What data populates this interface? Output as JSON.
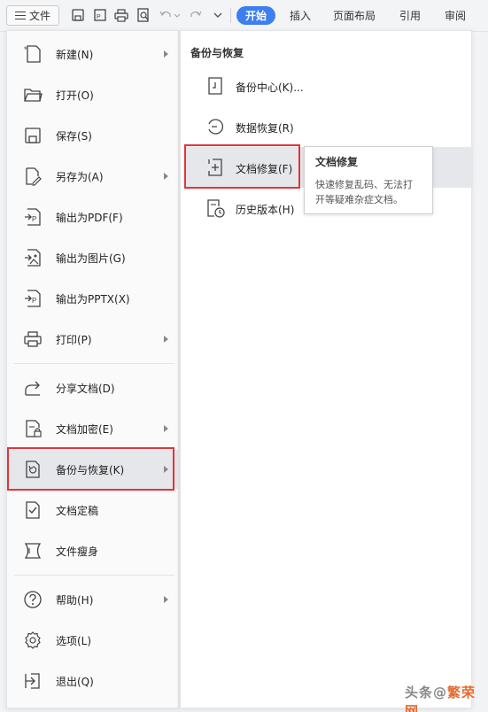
{
  "toolbar": {
    "file_label": "文件",
    "tabs": [
      {
        "label": "开始",
        "active": true
      },
      {
        "label": "插入"
      },
      {
        "label": "页面布局"
      },
      {
        "label": "引用"
      },
      {
        "label": "审阅"
      }
    ]
  },
  "menu": {
    "items": [
      {
        "label": "新建(N)",
        "icon": "new-doc-icon",
        "submenu": true
      },
      {
        "label": "打开(O)",
        "icon": "folder-open-icon",
        "submenu": false
      },
      {
        "label": "保存(S)",
        "icon": "save-icon",
        "submenu": false
      },
      {
        "label": "另存为(A)",
        "icon": "save-as-icon",
        "submenu": true
      },
      {
        "label": "输出为PDF(F)",
        "icon": "export-pdf-icon",
        "submenu": false
      },
      {
        "label": "输出为图片(G)",
        "icon": "export-image-icon",
        "submenu": false
      },
      {
        "label": "输出为PPTX(X)",
        "icon": "export-pptx-icon",
        "submenu": false
      },
      {
        "label": "打印(P)",
        "icon": "print-icon",
        "submenu": true
      },
      {
        "label": "分享文档(D)",
        "icon": "share-icon",
        "submenu": false
      },
      {
        "label": "文档加密(E)",
        "icon": "encrypt-doc-icon",
        "submenu": true
      },
      {
        "label": "备份与恢复(K)",
        "icon": "backup-restore-icon",
        "submenu": true,
        "highlighted": true
      },
      {
        "label": "文档定稿",
        "icon": "finalize-doc-icon",
        "submenu": false
      },
      {
        "label": "文件瘦身",
        "icon": "slim-file-icon",
        "submenu": false
      },
      {
        "label": "帮助(H)",
        "icon": "help-icon",
        "submenu": true
      },
      {
        "label": "选项(L)",
        "icon": "gear-icon",
        "submenu": false
      },
      {
        "label": "退出(Q)",
        "icon": "exit-icon",
        "submenu": false
      }
    ]
  },
  "submenu": {
    "title": "备份与恢复",
    "items": [
      {
        "label": "备份中心(K)...",
        "icon": "backup-center-icon"
      },
      {
        "label": "数据恢复(R)",
        "icon": "data-recovery-icon"
      },
      {
        "label": "文档修复(F)",
        "icon": "doc-repair-icon",
        "highlighted": true
      },
      {
        "label": "历史版本(H)",
        "icon": "history-version-icon"
      }
    ]
  },
  "tooltip": {
    "title": "文档修复",
    "body": "快速修复乱码、无法打开等疑难杂症文档。"
  },
  "watermark": {
    "prefix": "头条",
    "at": "@",
    "accent": "繁荣网",
    "accent_color": "#e66a2c"
  },
  "colors": {
    "accent": "#3d7ef1",
    "highlight_border": "#e4333a",
    "highlight_bg": "#e6e7ea"
  }
}
